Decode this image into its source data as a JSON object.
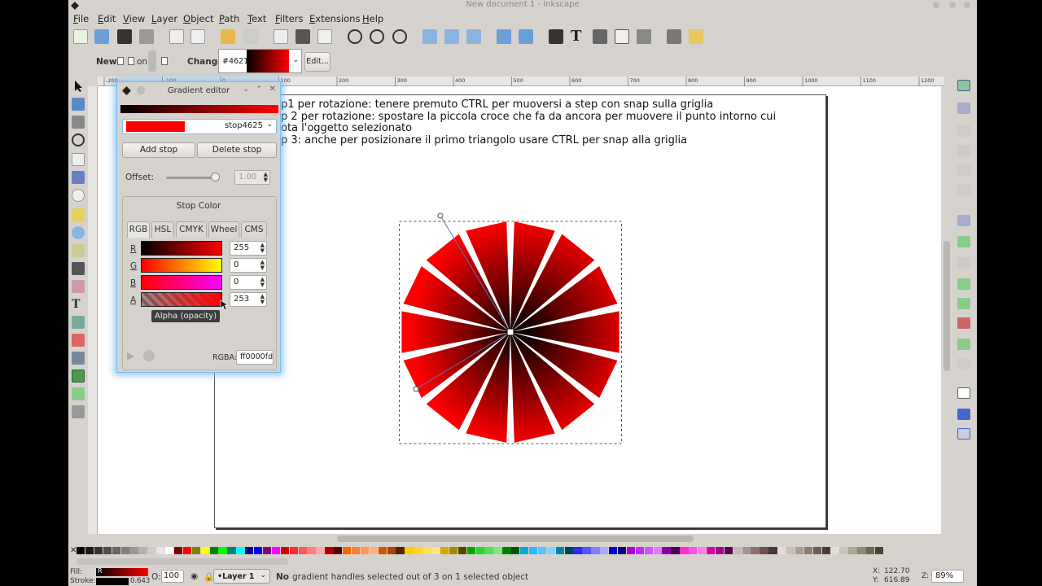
{
  "window": {
    "title": "New document 1 - Inkscape"
  },
  "menu": [
    "File",
    "Edit",
    "View",
    "Layer",
    "Object",
    "Path",
    "Text",
    "Filters",
    "Extensions",
    "Help"
  ],
  "controls": {
    "new_label": "New:",
    "on_label": "on",
    "change_label": "Change:",
    "gradient_id": "#4621",
    "edit_button": "Edit..."
  },
  "ruler_ticks": [
    "-200",
    "-100",
    "0",
    "100",
    "200",
    "300",
    "400",
    "500",
    "600",
    "700",
    "800",
    "900",
    "1000",
    "1100",
    "1200"
  ],
  "canvas_text": [
    "p1 per rotazione: tenere premuto CTRL per muoversi a step con snap sulla griglia",
    "p 2 per rotazione: spostare la piccola croce che fa da ancora per muovere il punto intorno cui",
    "ota l'oggetto selezionato",
    "p 3: anche per posizionare il primo triangolo usare CTRL per snap alla griglia"
  ],
  "gradient_editor": {
    "title": "Gradient editor",
    "stop_name": "stop4625",
    "add_stop": "Add stop",
    "delete_stop": "Delete stop",
    "offset_label": "Offset:",
    "offset_value": "1.00",
    "stop_color_label": "Stop Color",
    "tabs": [
      "RGB",
      "HSL",
      "CMYK",
      "Wheel",
      "CMS"
    ],
    "channels": [
      {
        "label": "R",
        "value": "255"
      },
      {
        "label": "G",
        "value": "0"
      },
      {
        "label": "B",
        "value": "0"
      },
      {
        "label": "A",
        "value": "253"
      }
    ],
    "tooltip": "Alpha (opacity)",
    "rgba_label": "RGBA:",
    "rgba_value": "ff0000fd"
  },
  "status": {
    "fill_label": "Fill:",
    "stroke_label": "Stroke:",
    "stroke_value": "0.643",
    "fill_swatch_label": "R",
    "opacity_label": "O:",
    "opacity_value": "100",
    "layer": "•Layer 1",
    "message_bold": "No",
    "message": "gradient handles selected out of 3 on 1 selected object",
    "x_label": "X:",
    "x_value": "122.70",
    "y_label": "Y:",
    "y_value": "616.89",
    "z_label": "Z:",
    "zoom": "89%"
  },
  "colors": {
    "accent": "#ff0000",
    "dark": "#000000",
    "dialog_glow": "#6eb4f0"
  }
}
